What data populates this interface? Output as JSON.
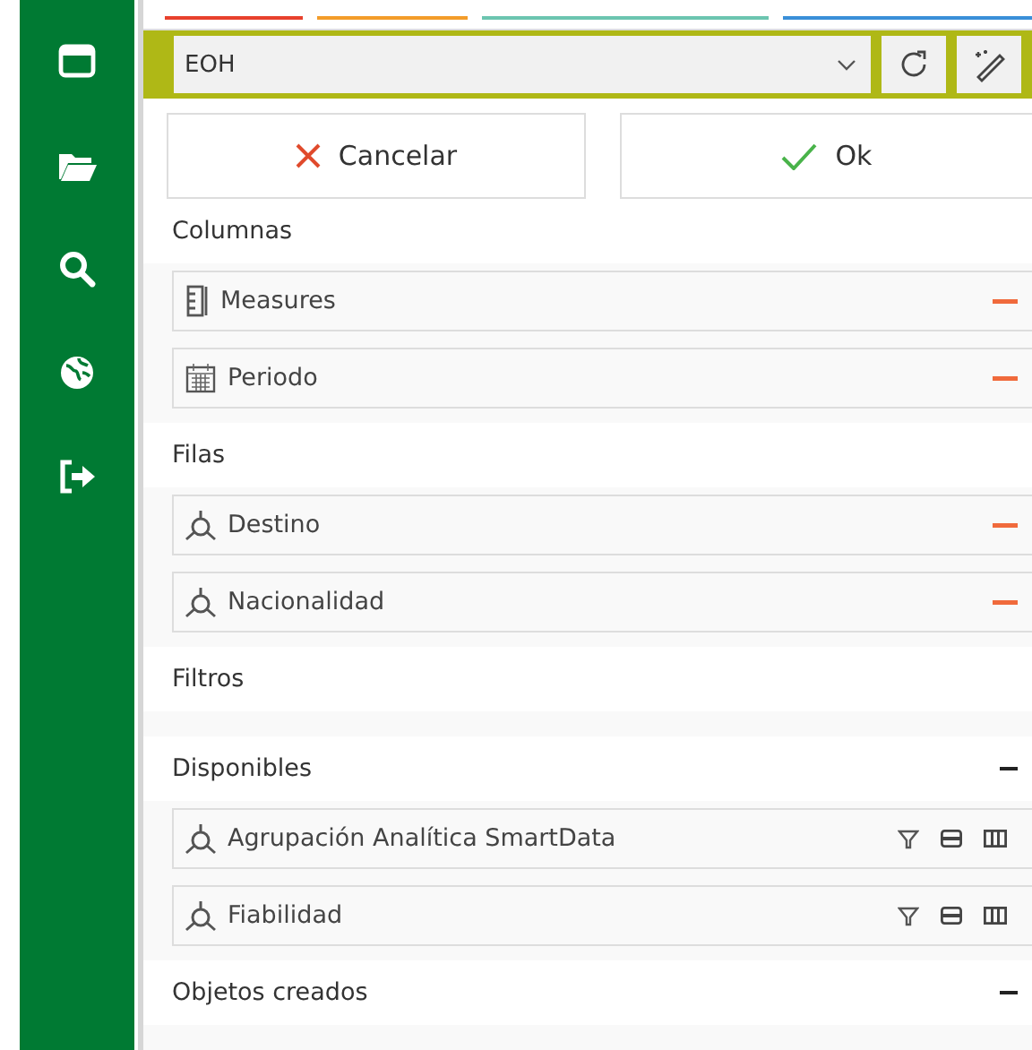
{
  "top_tabs": [
    {
      "color": "#e8412c"
    },
    {
      "color": "#f39c2a"
    },
    {
      "color": "#6cc5b0"
    },
    {
      "color": "#3a8fd8"
    }
  ],
  "toolbar": {
    "dropdown": {
      "value": "EOH"
    }
  },
  "buttons": [
    {
      "kind": "cancel",
      "label": "Cancelar"
    },
    {
      "kind": "ok",
      "label": "Ok"
    }
  ],
  "sections": [
    {
      "kind": "axis",
      "title": "Columnas",
      "collapsible": false,
      "items": [
        {
          "kind": "measure",
          "label": "Measures"
        },
        {
          "kind": "calendar",
          "label": "Periodo"
        }
      ]
    },
    {
      "kind": "axis",
      "title": "Filas",
      "collapsible": false,
      "items": [
        {
          "kind": "dimension",
          "label": "Destino"
        },
        {
          "kind": "dimension",
          "label": "Nacionalidad"
        }
      ]
    },
    {
      "title": "Filtros",
      "collapsible": false
    },
    {
      "kind": "pool",
      "title": "Disponibles",
      "collapsible": true,
      "items": [
        {
          "kind": "dimension",
          "label": "Agrupación Analítica SmartData"
        },
        {
          "kind": "dimension",
          "label": "Fiabilidad"
        }
      ]
    },
    {
      "title": "Objetos creados",
      "collapsible": true
    }
  ]
}
